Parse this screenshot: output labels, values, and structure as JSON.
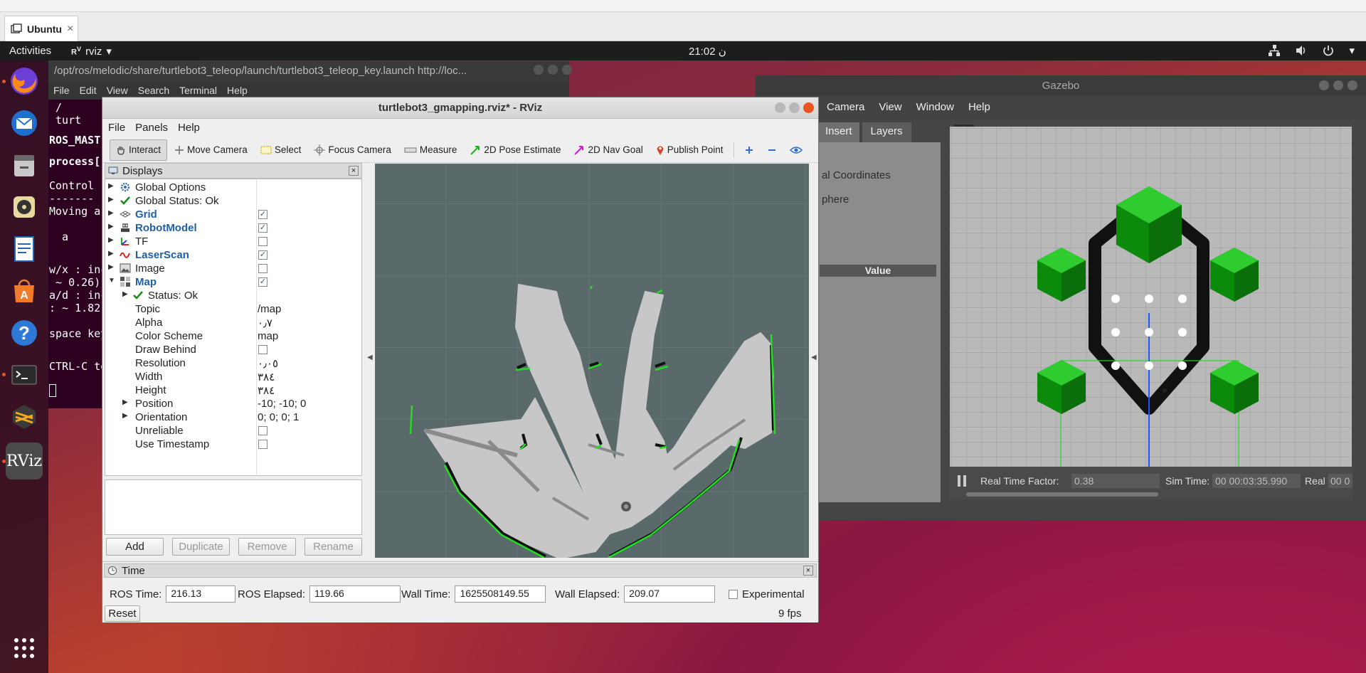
{
  "host": {
    "tab_label": "Ubuntu",
    "tab_close": "×"
  },
  "topbar": {
    "activities": "Activities",
    "app_label": "rviz",
    "app_arrow": "▾",
    "clock": "21:02 ن"
  },
  "terminal": {
    "title": "/opt/ros/melodic/share/turtlebot3_teleop/launch/turtlebot3_teleop_key.launch http://loc...",
    "menu": [
      "File",
      "Edit",
      "View",
      "Search",
      "Terminal",
      "Help"
    ],
    "lines": [
      " /",
      " turt",
      "ROS_MAST",
      "process[",
      "Control ",
      "-------",
      "Moving a",
      "",
      "  a",
      "",
      "w/x : inc",
      " ~ 0.26)",
      "a/d : inc",
      ": ~ 1.82",
      "space key",
      "",
      "CTRL-C to",
      ""
    ]
  },
  "gazebo": {
    "title": "Gazebo",
    "menu": [
      "Camera",
      "View",
      "Window",
      "Help"
    ],
    "tabs": [
      "Insert",
      "Layers"
    ],
    "left_items": [
      "al Coordinates",
      "phere"
    ],
    "value_header": "Value",
    "status": {
      "rtf_label": "Real Time Factor:",
      "rtf_value": "0.38",
      "sim_label": "Sim Time:",
      "sim_value": "00 00:03:35.990",
      "real_label": "Real Time:",
      "real_value": "00 0"
    }
  },
  "rviz": {
    "title": "turtlebot3_gmapping.rviz* - RViz",
    "menu": [
      "File",
      "Panels",
      "Help"
    ],
    "tools": {
      "interact": "Interact",
      "move_camera": "Move Camera",
      "select": "Select",
      "focus_camera": "Focus Camera",
      "measure": "Measure",
      "pose_estimate": "2D Pose Estimate",
      "nav_goal": "2D Nav Goal",
      "publish_point": "Publish Point"
    },
    "displays": {
      "header": "Displays",
      "rows": [
        {
          "label": "Global Options",
          "value": ""
        },
        {
          "label": "Global Status: Ok",
          "value": ""
        },
        {
          "label": "Grid",
          "value": ""
        },
        {
          "label": "RobotModel",
          "value": ""
        },
        {
          "label": "TF",
          "value": ""
        },
        {
          "label": "LaserScan",
          "value": ""
        },
        {
          "label": "Image",
          "value": ""
        },
        {
          "label": "Map",
          "value": ""
        },
        {
          "label": "Status: Ok",
          "value": ""
        },
        {
          "label": "Topic",
          "value": "/map"
        },
        {
          "label": "Alpha",
          "value": "٠٫٧"
        },
        {
          "label": "Color Scheme",
          "value": "map"
        },
        {
          "label": "Draw Behind",
          "value": ""
        },
        {
          "label": "Resolution",
          "value": "٠٫٠٥"
        },
        {
          "label": "Width",
          "value": "٣٨٤"
        },
        {
          "label": "Height",
          "value": "٣٨٤"
        },
        {
          "label": "Position",
          "value": "-10; -10; 0"
        },
        {
          "label": "Orientation",
          "value": "0; 0; 0; 1"
        },
        {
          "label": "Unreliable",
          "value": ""
        },
        {
          "label": "Use Timestamp",
          "value": ""
        }
      ],
      "checks": {
        "grid": true,
        "robotmodel": true,
        "tf": false,
        "laserscan": true,
        "image": false,
        "map": true,
        "draw_behind": false,
        "unreliable": false,
        "use_timestamp": false
      },
      "buttons": {
        "add": "Add",
        "duplicate": "Duplicate",
        "remove": "Remove",
        "rename": "Rename"
      }
    },
    "time": {
      "header": "Time",
      "ros_time_label": "ROS Time:",
      "ros_time": "216.13",
      "ros_elapsed_label": "ROS Elapsed:",
      "ros_elapsed": "119.66",
      "wall_time_label": "Wall Time:",
      "wall_time": "1625508149.55",
      "wall_elapsed_label": "Wall Elapsed:",
      "wall_elapsed": "209.07",
      "experimental_label": "Experimental",
      "reset": "Reset",
      "fps": "9 fps"
    }
  },
  "colors": {
    "ubuntu_orange": "#e95420",
    "terminal_bg": "#2c001e",
    "rviz_blue": "#1e5fa8",
    "laser_green": "#22dd22",
    "gazebo_green": "#11aa11"
  },
  "icons": [
    "firefox-icon",
    "thunderbird-icon",
    "files-icon",
    "rhythmbox-icon",
    "writer-icon",
    "software-icon",
    "help-icon",
    "terminal-icon",
    "sublime-icon",
    "rviz-icon",
    "app-grid-icon"
  ]
}
